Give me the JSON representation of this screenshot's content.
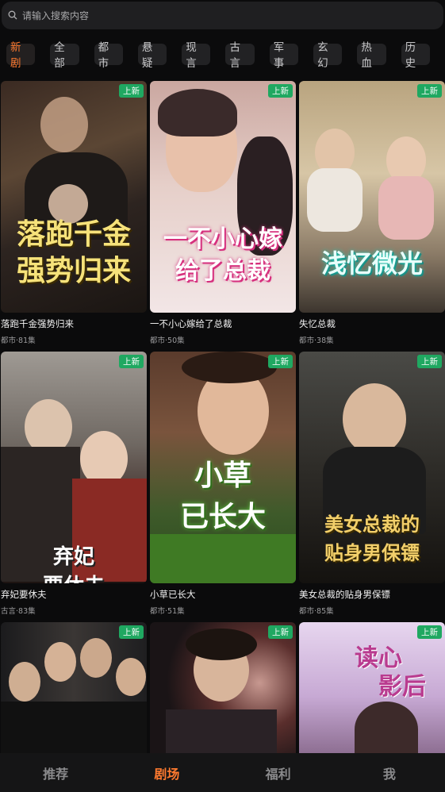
{
  "search": {
    "placeholder": "请输入搜索内容",
    "icon": "search-icon"
  },
  "categories": [
    {
      "label": "新剧",
      "active": true
    },
    {
      "label": "全部"
    },
    {
      "label": "都市"
    },
    {
      "label": "悬疑"
    },
    {
      "label": "现言"
    },
    {
      "label": "古言"
    },
    {
      "label": "军事"
    },
    {
      "label": "玄幻"
    },
    {
      "label": "热血"
    },
    {
      "label": "历史"
    }
  ],
  "colors": {
    "accent": "#ff7a2f",
    "badge": "#1fa861",
    "background": "#0b0b0c"
  },
  "dramas": [
    {
      "title": "落跑千金强势归来",
      "meta": "都市·81集",
      "badge": "上新",
      "poster_text": "落跑千金强势归来"
    },
    {
      "title": "一不小心嫁给了总裁",
      "meta": "都市·50集",
      "badge": "上新",
      "poster_text": "一不小心嫁给了总裁"
    },
    {
      "title": "失忆总裁",
      "meta": "都市·38集",
      "badge": "上新",
      "poster_text": "浅忆微光"
    },
    {
      "title": "弃妃要休夫",
      "meta": "古言·83集",
      "badge": "上新",
      "poster_text": "弃妃要休夫"
    },
    {
      "title": "小草已长大",
      "meta": "都市·51集",
      "badge": "上新",
      "poster_text": "小草已长大"
    },
    {
      "title": "美女总裁的贴身男保镖",
      "meta": "都市·85集",
      "badge": "上新",
      "poster_text": "美女总裁的贴身男保镖"
    },
    {
      "title": "",
      "meta": "",
      "badge": "上新",
      "poster_text": ""
    },
    {
      "title": "",
      "meta": "",
      "badge": "上新",
      "poster_text": ""
    },
    {
      "title": "",
      "meta": "",
      "badge": "上新",
      "poster_text": "读心影后"
    }
  ],
  "tabs": [
    {
      "label": "推荐"
    },
    {
      "label": "剧场",
      "active": true
    },
    {
      "label": "福利"
    },
    {
      "label": "我"
    }
  ]
}
